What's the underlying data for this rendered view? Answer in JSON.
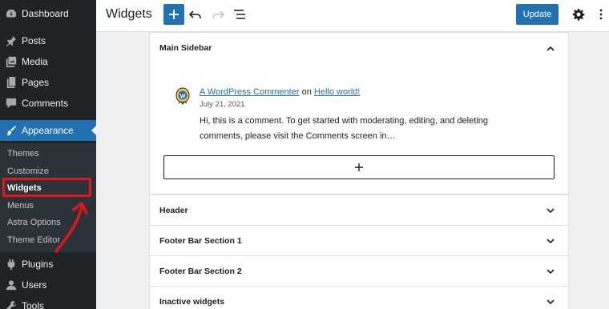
{
  "sidebar": {
    "items": [
      {
        "label": "Dashboard",
        "icon": "dashboard-icon"
      },
      {
        "label": "Posts",
        "icon": "pin-icon"
      },
      {
        "label": "Media",
        "icon": "media-icon"
      },
      {
        "label": "Pages",
        "icon": "pages-icon"
      },
      {
        "label": "Comments",
        "icon": "comment-icon"
      },
      {
        "label": "Appearance",
        "icon": "brush-icon"
      },
      {
        "label": "Plugins",
        "icon": "plugin-icon"
      },
      {
        "label": "Users",
        "icon": "users-icon"
      },
      {
        "label": "Tools",
        "icon": "wrench-icon"
      }
    ],
    "submenu": [
      "Themes",
      "Customize",
      "Widgets",
      "Menus",
      "Astra Options",
      "Theme Editor"
    ],
    "accent_color": "#2271b1",
    "annotation_color": "#e0161c"
  },
  "header": {
    "title": "Widgets",
    "update_label": "Update"
  },
  "widget_areas": {
    "main_sidebar": {
      "title": "Main Sidebar",
      "comment": {
        "author": "A WordPress Commenter",
        "on_word": "on",
        "post": "Hello world!",
        "date": "July 21, 2021",
        "text": "Hi, this is a comment. To get started with moderating, editing, and deleting comments, please visit the Comments screen in…"
      }
    },
    "header": "Header",
    "footer_1": "Footer Bar Section 1",
    "footer_2": "Footer Bar Section 2",
    "inactive": "Inactive widgets"
  }
}
